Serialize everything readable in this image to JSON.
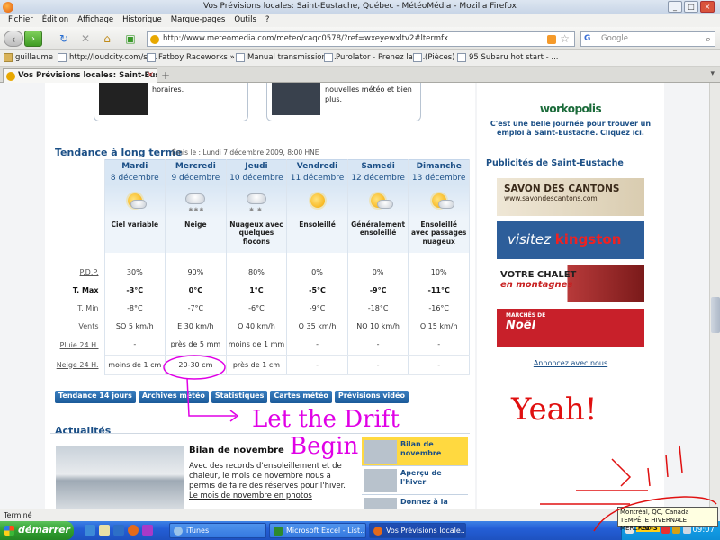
{
  "window": {
    "title": "Vos Prévisions locales: Saint-Eustache, Québec - MétéoMédia - Mozilla Firefox"
  },
  "menu": [
    "Fichier",
    "Édition",
    "Affichage",
    "Historique",
    "Marque-pages",
    "Outils",
    "?"
  ],
  "url": "http://www.meteomedia.com/meteo/caqc0578/?ref=wxeyewxltv2#ltermfx",
  "search": {
    "placeholder": "Google",
    "engine_icon": "G"
  },
  "bookmarks": [
    {
      "label": "guillaume",
      "icon": "folder"
    },
    {
      "label": "http://loudcity.com/st...",
      "icon": "page"
    },
    {
      "label": "Fatboy Raceworks » ...",
      "icon": "page"
    },
    {
      "label": "Manual transmission r...",
      "icon": "page"
    },
    {
      "label": "Purolator - Prenez la r...",
      "icon": "page"
    },
    {
      "label": "(Pièces)",
      "icon": "page"
    },
    {
      "label": "95 Subaru hot start - ...",
      "icon": "page"
    }
  ],
  "tab": {
    "label": "Vos Prévisions locales: Saint-Eustach..."
  },
  "promos": [
    {
      "text": "horaires."
    },
    {
      "text": "nouvelles météo et bien plus."
    }
  ],
  "forecast": {
    "title": "Tendance à long terme",
    "issued": "Émis le : Lundi 7 décembre 2009, 8:00 HNE",
    "days": [
      {
        "day": "Mardi",
        "date": "8 décembre",
        "icon": "sun-cloud-icon",
        "desc": "Ciel variable",
        "pdp": "30%",
        "tmax": "-3°C",
        "tmin": "-8°C",
        "vents": "SO 5 km/h",
        "pluie": "-",
        "neige": "moins de 1 cm"
      },
      {
        "day": "Mercredi",
        "date": "9 décembre",
        "icon": "snow-icon",
        "desc": "Neige",
        "pdp": "90%",
        "tmax": "0°C",
        "tmin": "-7°C",
        "vents": "E 30 km/h",
        "pluie": "près de 5 mm",
        "neige": "20-30 cm"
      },
      {
        "day": "Jeudi",
        "date": "10 décembre",
        "icon": "cloud-flurries-icon",
        "desc": "Nuageux avec quelques flocons",
        "pdp": "80%",
        "tmax": "1°C",
        "tmin": "-6°C",
        "vents": "O 40 km/h",
        "pluie": "moins de 1 mm",
        "neige": "près de 1 cm"
      },
      {
        "day": "Vendredi",
        "date": "11 décembre",
        "icon": "sun-icon",
        "desc": "Ensoleillé",
        "pdp": "0%",
        "tmax": "-5°C",
        "tmin": "-9°C",
        "vents": "O 35 km/h",
        "pluie": "-",
        "neige": "-"
      },
      {
        "day": "Samedi",
        "date": "12 décembre",
        "icon": "sun-cloud-icon",
        "desc": "Généralement ensoleillé",
        "pdp": "0%",
        "tmax": "-9°C",
        "tmin": "-18°C",
        "vents": "NO 10 km/h",
        "pluie": "-",
        "neige": "-"
      },
      {
        "day": "Dimanche",
        "date": "13 décembre",
        "icon": "sun-cloud-icon",
        "desc": "Ensoleillé avec passages nuageux",
        "pdp": "10%",
        "tmax": "-11°C",
        "tmin": "-16°C",
        "vents": "O 15 km/h",
        "pluie": "-",
        "neige": "-"
      }
    ],
    "row_labels": {
      "pdp": "P.D.P.",
      "tmax": "T. Max",
      "tmin": "T. Min",
      "vents": "Vents",
      "pluie": "Pluie 24 H.",
      "neige": "Neige 24 H."
    }
  },
  "buttons": [
    "Tendance 14 jours",
    "Archives météo",
    "Statistiques",
    "Cartes météo",
    "Prévisions vidéo"
  ],
  "news": {
    "title": "Actualités",
    "headline": "Bilan de novembre",
    "body": "Avec des records d'ensoleillement et de chaleur, le mois de novembre nous a permis de faire des réserves pour l'hiver.",
    "link": "Le mois de novembre en photos",
    "list": [
      "Bilan de novembre",
      "Aperçu de l'hiver",
      "Donnez à la"
    ]
  },
  "sidebar": {
    "workopolis_logo": "workopolis",
    "workopolis_text": "C'est une belle journée pour trouver un emploi à Saint-Eustache. Cliquez ici.",
    "pub_title": "Publicités de Saint-Eustache",
    "ads": [
      {
        "title": "SAVON DES CANTONS",
        "sub": "www.savondescantons.com"
      },
      {
        "pre": "visitez ",
        "name": "kingston"
      },
      {
        "line1": "VOTRE CHALET",
        "line2": "en montagnes"
      },
      {
        "line1": "MARCHÉS DE",
        "line2": "Noël"
      }
    ],
    "annoncez": "Annoncez avec nous"
  },
  "status": "Terminé",
  "tooltip": {
    "line1": "Montréal, QC, Canada",
    "line2": "TEMPÊTE HIVERNALE MERCREDI"
  },
  "taskbar": {
    "start": "démarrer",
    "tasks": [
      "iTunes",
      "Microsoft Excel - List...",
      "Vos Prévisions locale..."
    ],
    "clock": "09:07",
    "tray_temp": "-10",
    "tray_temp2": "-3"
  },
  "annotations": {
    "drift": "Let the Drift",
    "begin": "Begin",
    "yeah": "Yeah!"
  },
  "colors": {
    "brand": "#1b4f86",
    "annotation": "#e000e6",
    "annotation_red": "#e01010"
  }
}
